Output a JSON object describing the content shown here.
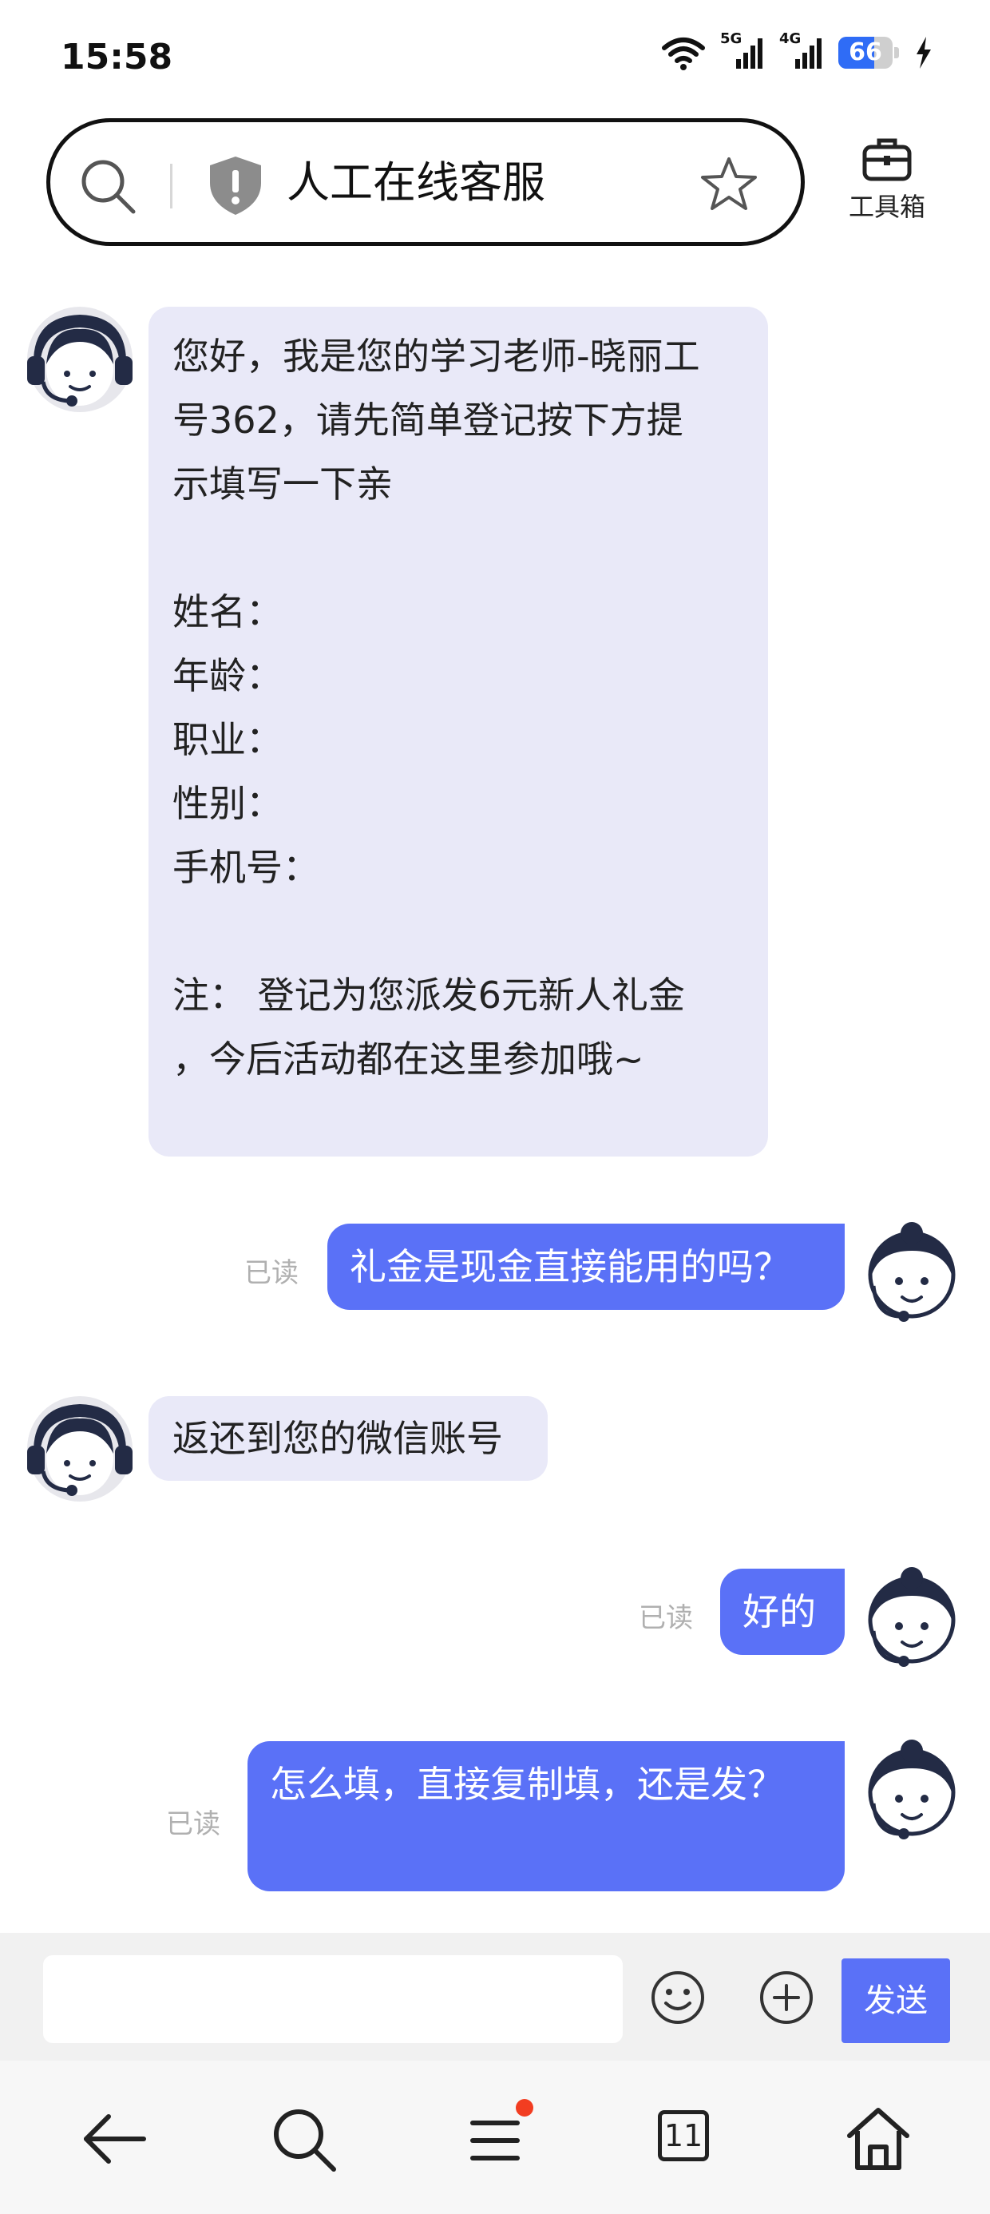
{
  "status_bar": {
    "time": "15:58",
    "signal_labels": [
      "5G",
      "4G"
    ],
    "battery_level": "66",
    "battery_fraction": 0.66
  },
  "address_bar": {
    "title": "人工在线客服",
    "icons": [
      "search-icon",
      "shield-alert-icon",
      "star-icon"
    ]
  },
  "toolbox": {
    "label": "工具箱",
    "icon": "toolbox-icon"
  },
  "chat": {
    "messages": [
      {
        "sender": "agent",
        "text": "您好，我是您的学习老师-晓丽工\n号362，请先简单登记按下方提\n示填写一下亲\n\n姓名：\n年龄：\n职业：\n性别：\n手机号：\n\n注： 登记为您派发6元新人礼金\n，今后活动都在这里参加哦~\n"
      },
      {
        "sender": "user",
        "status": "已读",
        "text": "礼金是现金直接能用的吗？"
      },
      {
        "sender": "agent",
        "text": "返还到您的微信账号"
      },
      {
        "sender": "user",
        "status": "已读",
        "text": "好的"
      },
      {
        "sender": "user",
        "status": "已读",
        "text": "怎么填，直接复制填，还是发？\n"
      }
    ]
  },
  "input_bar": {
    "placeholder": "",
    "value": "",
    "send_label": "发送",
    "icons": [
      "emoji-icon",
      "plus-circle-icon"
    ]
  },
  "bottom_nav": {
    "items": [
      {
        "name": "back",
        "icon": "arrow-left-icon"
      },
      {
        "name": "search",
        "icon": "search-icon"
      },
      {
        "name": "menu",
        "icon": "menu-icon",
        "has_badge": true
      },
      {
        "name": "tabs",
        "icon": "tabs-icon",
        "count": "11"
      },
      {
        "name": "home",
        "icon": "home-icon"
      }
    ]
  },
  "colors": {
    "accent": "#5a71f7",
    "agent_bubble": "#e9e9f8",
    "read_label": "#b0b0b0",
    "badge": "#f23d21",
    "battery": "#2f6cf6"
  }
}
